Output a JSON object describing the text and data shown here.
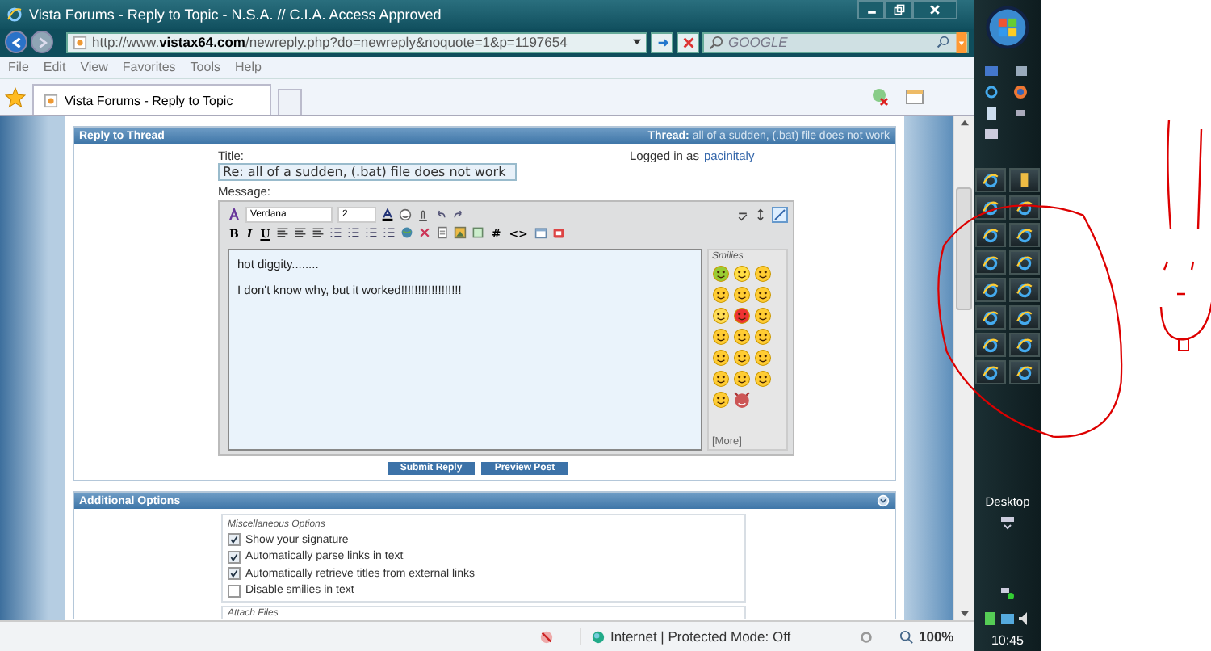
{
  "window": {
    "title": "Vista Forums - Reply to Topic - N.S.A. // C.I.A. Access Approved"
  },
  "address_bar": {
    "url": "http://www.**vistax64.com**/newreply.php?do=newreply&noquote=1&p=1197654"
  },
  "search": {
    "placeholder": "GOOGLE"
  },
  "menu": [
    "File",
    "Edit",
    "View",
    "Favorites",
    "Tools",
    "Help"
  ],
  "tabs": [
    {
      "label": "Vista Forums - Reply to Topic",
      "selected": true
    }
  ],
  "reply_panel": {
    "title": "Reply to Thread",
    "thread": "**Thread:** all of a sudden, (.bat) file does not work",
    "title_label": "Title:",
    "title_value": "Re: all of a sudden, (.bat) file does not work",
    "logged_in_label": "Logged in as",
    "username": "pacinitaly",
    "message_label": "Message:",
    "editor": {
      "font": "Verdana",
      "size": "2",
      "format_buttons": [
        "B",
        "I",
        "U"
      ],
      "code_buttons": [
        "#",
        "<>"
      ],
      "message_lines": [
        "hot diggity........",
        "I don't know why, but it worked!!!!!!!!!!!!!!!!!!"
      ],
      "smilies_title": "Smilies",
      "more_link": "[More]"
    },
    "buttons": [
      "Submit Reply",
      "Preview Post"
    ]
  },
  "options_panel": {
    "title": "Additional Options",
    "fieldset": "Miscellaneous Options",
    "options": [
      {
        "label": "Show your signature",
        "checked": true
      },
      {
        "label": "Automatically parse links in text",
        "checked": true
      },
      {
        "label": "Automatically retrieve titles from external links",
        "checked": true
      },
      {
        "label": "Disable smilies in text",
        "checked": false
      }
    ],
    "next_fieldset": "Attach Files"
  },
  "status_bar": {
    "zone": "Internet | Protected Mode: Off",
    "zoom": "100%"
  },
  "taskbar": {
    "desktop_label": "Desktop",
    "clock": "10:45"
  }
}
